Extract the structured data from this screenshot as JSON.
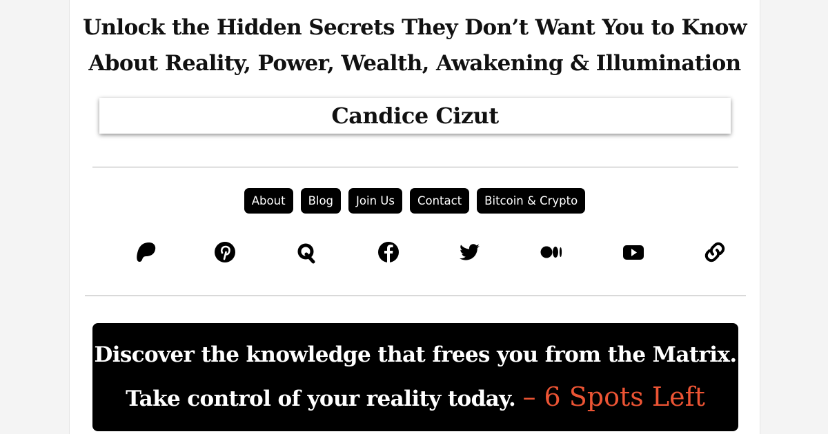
{
  "header": {
    "headline_line1": "Unlock the Hidden Secrets They Don’t Want You to Know",
    "headline_line2": "About Reality, Power, Wealth, Awakening & Illumination",
    "author_name": "Candice Cizut"
  },
  "nav": {
    "items": [
      {
        "label": "About"
      },
      {
        "label": "Blog"
      },
      {
        "label": "Join Us"
      },
      {
        "label": "Contact"
      },
      {
        "label": "Bitcoin & Crypto"
      }
    ]
  },
  "social": {
    "icons": [
      "patreon-icon",
      "pinterest-icon",
      "quora-icon",
      "facebook-icon",
      "twitter-icon",
      "medium-icon",
      "youtube-icon",
      "link-icon"
    ]
  },
  "cta": {
    "line1": "Discover the knowledge that frees you from the Matrix.",
    "line2": "Take control of your reality today.",
    "spots": "– 6 Spots Left",
    "accent_color": "#ec5434"
  }
}
